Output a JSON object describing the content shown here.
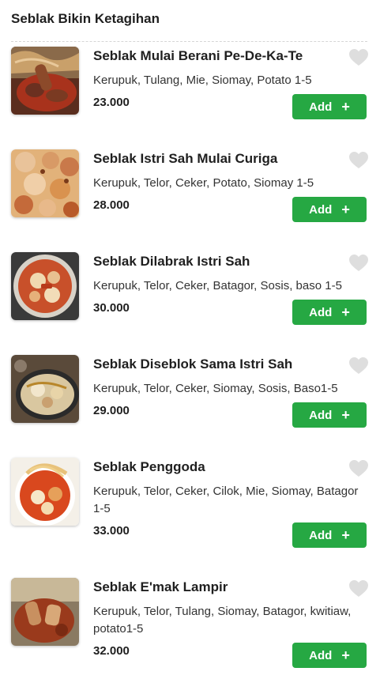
{
  "section": {
    "title": "Seblak Bikin Ketagihan"
  },
  "items": [
    {
      "name": "Seblak Mulai Berani Pe-De-Ka-Te",
      "description": "Kerupuk, Tulang, Mie, Siomay, Potato 1-5",
      "price": "23.000",
      "add_label": "Add"
    },
    {
      "name": "Seblak Istri Sah Mulai Curiga",
      "description": "Kerupuk, Telor, Ceker, Potato, Siomay 1-5",
      "price": "28.000",
      "add_label": "Add"
    },
    {
      "name": "Seblak Dilabrak Istri Sah",
      "description": "Kerupuk, Telor, Ceker, Batagor, Sosis, baso 1-5",
      "price": "30.000",
      "add_label": "Add"
    },
    {
      "name": "Seblak Diseblok Sama Istri Sah",
      "description": "Kerupuk, Telor, Ceker, Siomay, Sosis, Baso1-5",
      "price": "29.000",
      "add_label": "Add"
    },
    {
      "name": "Seblak Penggoda",
      "description": "Kerupuk, Telor, Ceker, Cilok, Mie, Siomay, Batagor 1-5",
      "price": "33.000",
      "add_label": "Add"
    },
    {
      "name": "Seblak E'mak Lampir",
      "description": "Kerupuk, Telor, Tulang, Siomay, Batagor, kwitiaw, potato1-5",
      "price": "32.000",
      "add_label": "Add"
    }
  ],
  "colors": {
    "add_button": "#26a843",
    "favorite_icon": "#dedede"
  }
}
